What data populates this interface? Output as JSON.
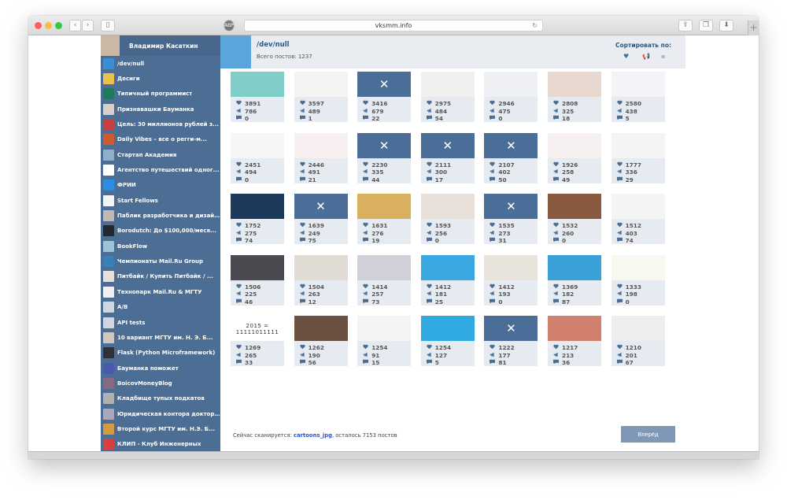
{
  "browser": {
    "url": "vksmm.info",
    "traffic_colors": [
      "#fc605c",
      "#fdbc40",
      "#34c84a"
    ]
  },
  "sidebar": {
    "user_name": "Владимир Касаткин",
    "items": [
      {
        "label": "/dev/null",
        "color": "#3a8fd0"
      },
      {
        "label": "Десиги",
        "color": "#e8c24a"
      },
      {
        "label": "Типичный программист",
        "color": "#1f7a5e"
      },
      {
        "label": "Признавашки Бауманка",
        "color": "#d8d0c8"
      },
      {
        "label": "Цель: 30 миллионов рублей з...",
        "color": "#c84040"
      },
      {
        "label": "Daily Vibes – все о регги-м...",
        "color": "#d05a30"
      },
      {
        "label": "Стартап Академия",
        "color": "#8fb0c8"
      },
      {
        "label": "Агентство путешествий одног...",
        "color": "#ffffff"
      },
      {
        "label": "ФРИИ",
        "color": "#2a8fe0"
      },
      {
        "label": "Start Fellows",
        "color": "#f4f4f4"
      },
      {
        "label": "Паблик разработчика и дизай...",
        "color": "#c0b8b4"
      },
      {
        "label": "Borodutch: До $100,000/меся...",
        "color": "#202830"
      },
      {
        "label": "BookFlow",
        "color": "#9cc4d8"
      },
      {
        "label": "Чемпионаты Mail.Ru Group",
        "color": "#3a80b8"
      },
      {
        "label": "Питбайк / Купить Питбайк / ...",
        "color": "#e8e0d8"
      },
      {
        "label": "Технопарк Mail.Ru & МГТУ",
        "color": "#f0f0f0"
      },
      {
        "label": "A/B",
        "color": "#cfd8e2"
      },
      {
        "label": "API tests",
        "color": "#cfd8e2"
      },
      {
        "label": "10 вариант МГТУ им. Н. Э. Б...",
        "color": "#d0c8c0"
      },
      {
        "label": "Flask (Python Microframework)",
        "color": "#303038"
      },
      {
        "label": "Бауманка поможет",
        "color": "#4a5ab0"
      },
      {
        "label": "BoicovMoneyBlog",
        "color": "#8a6a80"
      },
      {
        "label": "Кладбище тупых подкатов",
        "color": "#b0b0b0"
      },
      {
        "label": "Юридическая контора доктора...",
        "color": "#a8a8b8"
      },
      {
        "label": "Второй курс МГТУ им. Н.Э. Б...",
        "color": "#d89a40"
      },
      {
        "label": "КЛИП - Клуб Инженерных",
        "color": "#d84040"
      }
    ]
  },
  "group": {
    "name": "/dev/null",
    "total_posts": "Всего постов: 1237",
    "sort_label": "Сортировать по:"
  },
  "posts": [
    {
      "likes": "3891",
      "reposts": "786",
      "comments": "0",
      "thumb": "#7fcfc8"
    },
    {
      "likes": "3597",
      "reposts": "489",
      "comments": "1",
      "thumb": "#f4f4f4"
    },
    {
      "likes": "3416",
      "reposts": "679",
      "comments": "22",
      "deleted": true
    },
    {
      "likes": "2975",
      "reposts": "484",
      "comments": "54",
      "thumb": "#f0f0f0"
    },
    {
      "likes": "2946",
      "reposts": "475",
      "comments": "0",
      "thumb": "#eef0f4"
    },
    {
      "likes": "2808",
      "reposts": "325",
      "comments": "18",
      "thumb": "#e8d8d0"
    },
    {
      "likes": "2580",
      "reposts": "438",
      "comments": "5",
      "thumb": "#f4f4f8"
    },
    {
      "likes": "2451",
      "reposts": "494",
      "comments": "0",
      "thumb": "#f6f6f6"
    },
    {
      "likes": "2446",
      "reposts": "491",
      "comments": "21",
      "thumb": "#f8f0f0"
    },
    {
      "likes": "2230",
      "reposts": "335",
      "comments": "44",
      "deleted": true
    },
    {
      "likes": "2111",
      "reposts": "300",
      "comments": "17",
      "deleted": true
    },
    {
      "likes": "2107",
      "reposts": "402",
      "comments": "50",
      "deleted": true
    },
    {
      "likes": "1926",
      "reposts": "258",
      "comments": "49",
      "thumb": "#f6f0f0"
    },
    {
      "likes": "1777",
      "reposts": "336",
      "comments": "29",
      "thumb": "#f4f4f4"
    },
    {
      "likes": "1752",
      "reposts": "275",
      "comments": "74",
      "thumb": "#1c3a5c"
    },
    {
      "likes": "1639",
      "reposts": "249",
      "comments": "75",
      "deleted": true
    },
    {
      "likes": "1631",
      "reposts": "276",
      "comments": "19",
      "thumb": "#d8b060"
    },
    {
      "likes": "1593",
      "reposts": "256",
      "comments": "0",
      "thumb": "#e8e0d8"
    },
    {
      "likes": "1535",
      "reposts": "273",
      "comments": "31",
      "deleted": true
    },
    {
      "likes": "1532",
      "reposts": "260",
      "comments": "0",
      "thumb": "#8a5a40"
    },
    {
      "likes": "1512",
      "reposts": "403",
      "comments": "74",
      "thumb": "#f4f4f4"
    },
    {
      "likes": "1506",
      "reposts": "225",
      "comments": "46",
      "thumb": "#4a4a50"
    },
    {
      "likes": "1504",
      "reposts": "263",
      "comments": "12",
      "thumb": "#e0dcd4"
    },
    {
      "likes": "1414",
      "reposts": "257",
      "comments": "73",
      "thumb": "#d0d0d8"
    },
    {
      "likes": "1412",
      "reposts": "181",
      "comments": "25",
      "thumb": "#3aa8e0"
    },
    {
      "likes": "1412",
      "reposts": "193",
      "comments": "0",
      "thumb": "#e8e4dc"
    },
    {
      "likes": "1369",
      "reposts": "182",
      "comments": "87",
      "thumb": "#3aa0d8"
    },
    {
      "likes": "1333",
      "reposts": "198",
      "comments": "0",
      "thumb": "#f8f8f0"
    },
    {
      "likes": "1269",
      "reposts": "265",
      "comments": "33",
      "thumb": "#ffffff",
      "text": "2015 = 11111011111"
    },
    {
      "likes": "1262",
      "reposts": "190",
      "comments": "56",
      "thumb": "#6a5040"
    },
    {
      "likes": "1254",
      "reposts": "91",
      "comments": "15",
      "thumb": "#f4f4f4"
    },
    {
      "likes": "1254",
      "reposts": "127",
      "comments": "5",
      "thumb": "#30a8e0"
    },
    {
      "likes": "1222",
      "reposts": "177",
      "comments": "81",
      "deleted": true
    },
    {
      "likes": "1217",
      "reposts": "213",
      "comments": "36",
      "thumb": "#d0806c"
    },
    {
      "likes": "1210",
      "reposts": "201",
      "comments": "67",
      "thumb": "#eeeeee"
    }
  ],
  "footer": {
    "prefix": "Сейчас сканируется: ",
    "link": "cartoons_jpg",
    "suffix": ", осталось 7153 постов",
    "next_label": "Вперёд"
  }
}
